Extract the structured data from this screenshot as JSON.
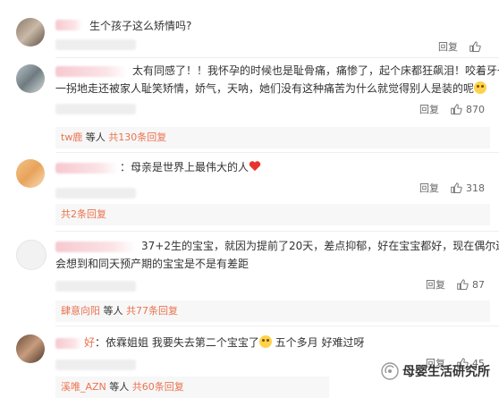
{
  "comments": [
    {
      "text": "生个孩子这么矫情吗?",
      "reply_label": "回复",
      "likes": ""
    },
    {
      "text_line1": "太有同感了！！我怀孕的时候也是耻骨痛，痛惨了，起个床都狂飙泪！咬着牙一瘸",
      "text_line2": "一拐地走还被家人耻笑矫情，娇气，天呐，她们没有这种痛苦为什么就觉得别人是装的呢",
      "reply_label": "回复",
      "likes": "870",
      "sub_author": "tw鹿",
      "sub_middle": " 等人 ",
      "sub_count": "共130条回复"
    },
    {
      "text": "：母亲是世界上最伟大的人",
      "reply_label": "回复",
      "likes": "318",
      "sub_count": "共2条回复"
    },
    {
      "text_line1": "37+2生的宝宝，就因为提前了20天，差点抑郁，好在宝宝都好，现在偶尔还",
      "text_line2": "会想到和同天预产期的宝宝是不是有差距",
      "reply_label": "回复",
      "likes": "87",
      "sub_author": "肆意向阳",
      "sub_middle": " 等人 ",
      "sub_count": "共77条回复"
    },
    {
      "name_tail": "好",
      "text": "：依霖姐姐 我要失去第二个宝宝了",
      "text_tail": " 五个多月 好难过呀",
      "reply_label": "回复",
      "likes": "45",
      "sub_author": "溪唯_AZN",
      "sub_middle": " 等人 ",
      "sub_count": "共60条回复"
    }
  ],
  "watermark": {
    "text": "母婴生活研究所"
  },
  "colors": {
    "accent": "#eb7350",
    "subbg": "#f7f7f7"
  }
}
